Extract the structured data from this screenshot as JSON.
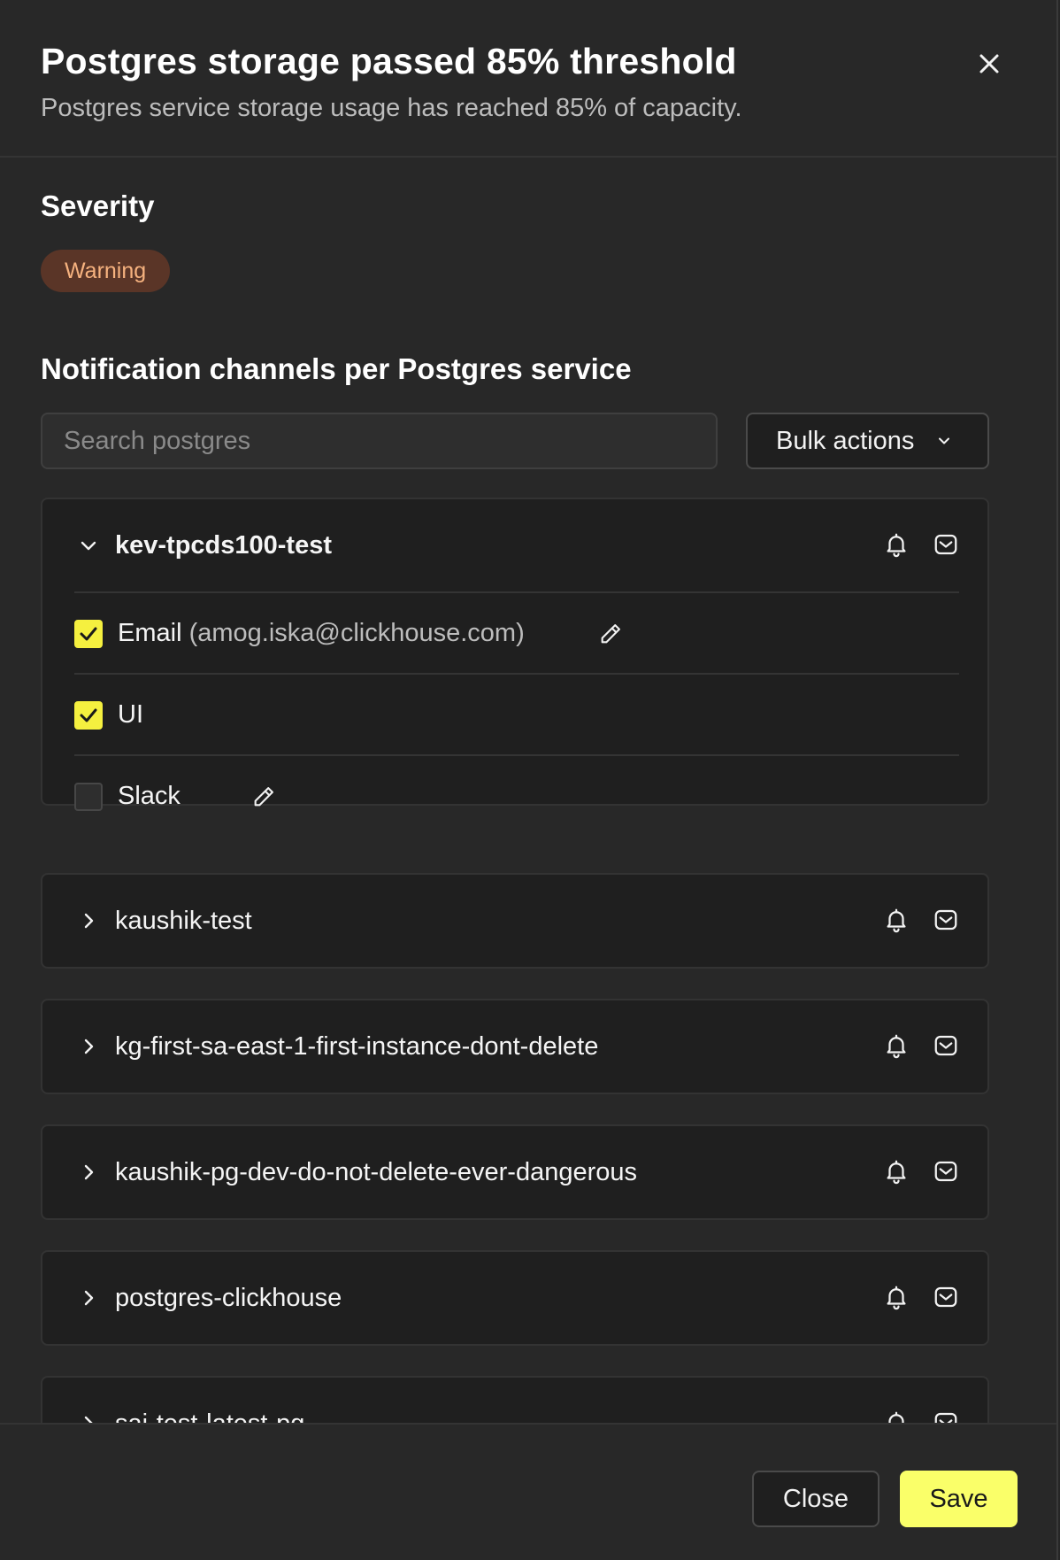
{
  "header": {
    "title": "Postgres storage passed 85% threshold",
    "subtitle": "Postgres service storage usage has reached 85% of capacity."
  },
  "severity": {
    "label": "Severity",
    "value": "Warning"
  },
  "notifications": {
    "label": "Notification channels per Postgres service",
    "search_placeholder": "Search postgres",
    "bulk_label": "Bulk actions"
  },
  "services": [
    {
      "name": "kev-tpcds100-test",
      "expanded": true,
      "channels": [
        {
          "label": "Email",
          "detail": "(amog.iska@clickhouse.com)",
          "checked": true,
          "editable": true
        },
        {
          "label": "UI",
          "detail": "",
          "checked": true,
          "editable": false
        },
        {
          "label": "Slack",
          "detail": "",
          "checked": false,
          "editable": true
        }
      ]
    },
    {
      "name": "kaushik-test",
      "expanded": false
    },
    {
      "name": "kg-first-sa-east-1-first-instance-dont-delete",
      "expanded": false
    },
    {
      "name": "kaushik-pg-dev-do-not-delete-ever-dangerous",
      "expanded": false
    },
    {
      "name": "postgres-clickhouse",
      "expanded": false
    },
    {
      "name": "sai-test-latest-pg",
      "expanded": false
    }
  ],
  "footer": {
    "close_label": "Close",
    "save_label": "Save"
  },
  "icons": {
    "close": "close-icon",
    "chevron_down": "chevron-down-icon",
    "chevron_right": "chevron-right-icon",
    "bell": "bell-icon",
    "mail": "mail-icon",
    "pencil": "pencil-icon",
    "check": "check-icon"
  },
  "colors": {
    "accent": "#faff69",
    "checkbox_on": "#f5f03f",
    "warning_bg": "#5a3527",
    "warning_text": "#f6b27f"
  }
}
